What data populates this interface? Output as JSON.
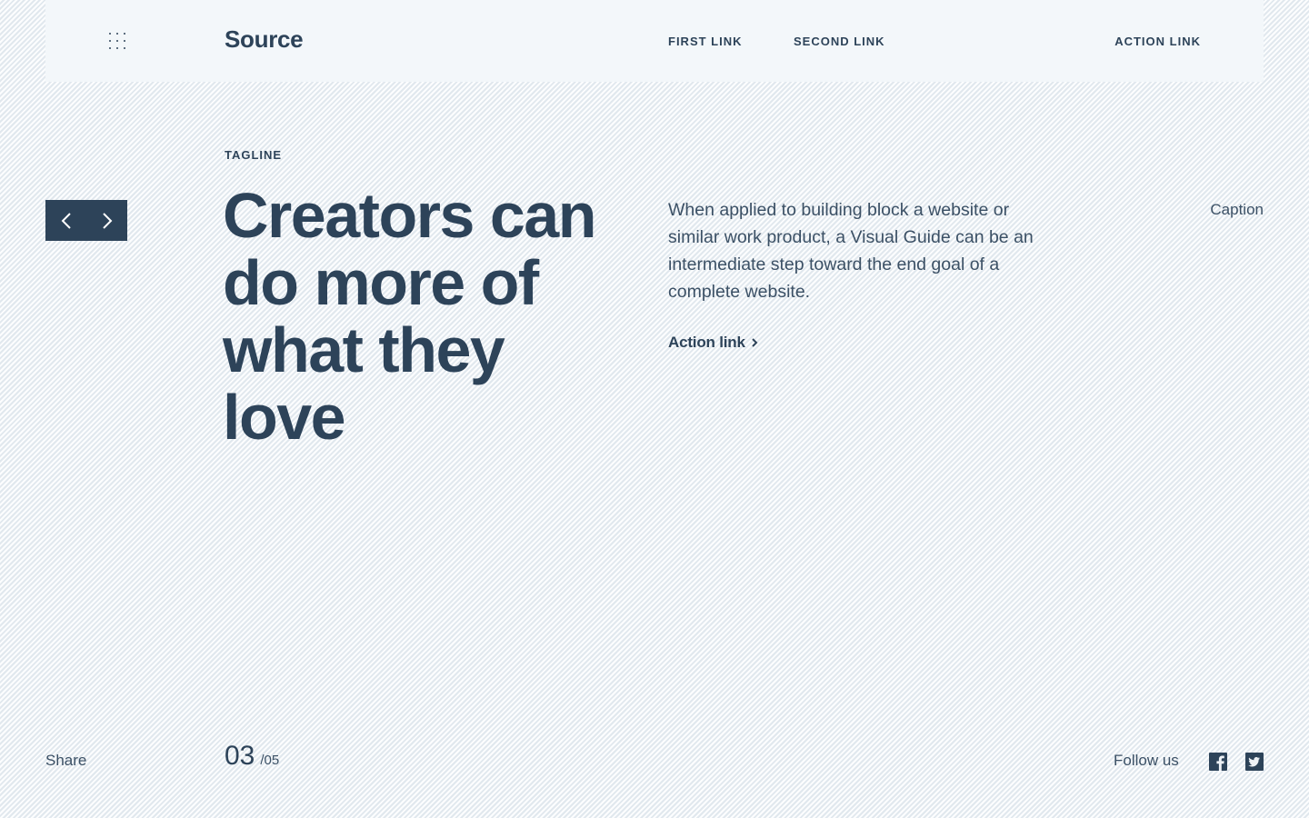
{
  "header": {
    "logo": "Source",
    "nav": {
      "first_link": "FIRST LINK",
      "second_link": "SECOND LINK",
      "action_link": "ACTION LINK"
    },
    "menu_icon": "grid-dots-icon"
  },
  "slider": {
    "prev_icon": "chevron-left-icon",
    "next_icon": "chevron-right-icon"
  },
  "hero": {
    "tagline": "TAGLINE",
    "headline": "Creators can do more of what they love",
    "body": "When applied to building block a website or similar work product, a Visual Guide can be an intermediate step toward the end goal of a complete website.",
    "action_link": "Action link",
    "caption": "Caption"
  },
  "footer": {
    "share_label": "Share",
    "pager_current": "03",
    "pager_total": "/05",
    "follow_label": "Follow us",
    "social": [
      "facebook-icon",
      "twitter-icon"
    ]
  },
  "colors": {
    "primary": "#2d4359",
    "background": "#eef2f6",
    "header_bg": "#f3f7fa"
  }
}
